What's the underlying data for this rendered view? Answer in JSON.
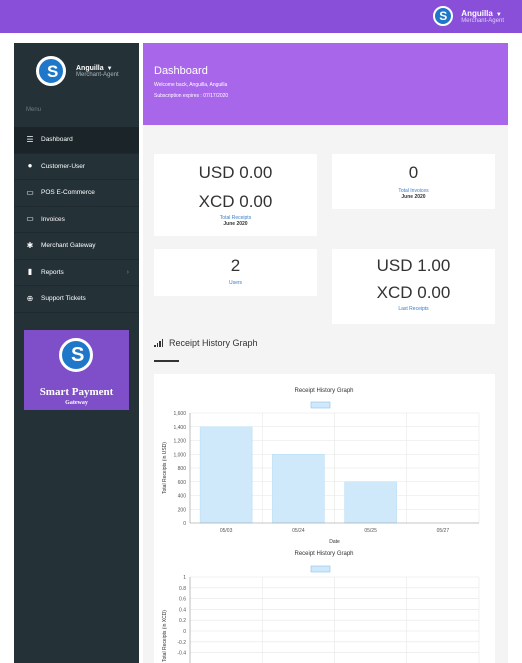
{
  "topbar": {
    "user_name": "Anguilla",
    "user_role": "Merchant-Agent"
  },
  "sidebar": {
    "user_name": "Anguilla",
    "user_role": "Merchant-Agent",
    "menu_label": "Menu",
    "items": [
      {
        "label": "Dashboard",
        "icon": "list-icon"
      },
      {
        "label": "Customer-User",
        "icon": "user-icon"
      },
      {
        "label": "POS E-Commerce",
        "icon": "card-icon"
      },
      {
        "label": "Invoices",
        "icon": "card-icon"
      },
      {
        "label": "Merchant Gateway",
        "icon": "gear-icon"
      },
      {
        "label": "Reports",
        "icon": "file-icon"
      },
      {
        "label": "Support Tickets",
        "icon": "lifebuoy-icon"
      }
    ],
    "promo": {
      "title": "Smart Payment",
      "subtitle": "Gateway"
    }
  },
  "hero": {
    "title": "Dashboard",
    "welcome": "Welcome back, Anguilla, Anguilla",
    "subscription": "Subscription expires : 07/17/2020"
  },
  "cards": {
    "receipts": {
      "usd": "USD 0.00",
      "xcd": "XCD 0.00",
      "label": "Total Receipts",
      "date": "June 2020"
    },
    "invoices": {
      "value": "0",
      "label": "Total Invoices",
      "date": "June 2020"
    },
    "users": {
      "value": "2",
      "label": "Users"
    },
    "last_receipts": {
      "usd": "USD 1.00",
      "xcd": "XCD 0.00",
      "label": "Last Receipts"
    }
  },
  "section_title": "Receipt History Graph",
  "chart_data": [
    {
      "type": "bar",
      "title": "Receipt History Graph",
      "xlabel": "Date",
      "ylabel": "Total Receipts (in USD)",
      "categories": [
        "05/03",
        "05/24",
        "05/25",
        "05/27"
      ],
      "values": [
        1400,
        1000,
        600,
        0
      ],
      "yticks": [
        "0",
        "200",
        "400",
        "600",
        "800",
        "1,000",
        "1,200",
        "1,400",
        "1,600"
      ],
      "ylim": [
        0,
        1600
      ],
      "color": "#cfe8fa",
      "grid": true
    },
    {
      "type": "bar",
      "title": "Receipt History Graph",
      "ylabel": "Total Receipts (in XCD)",
      "yticks": [
        "1",
        "0.8",
        "0.6",
        "0.4",
        "0.2",
        "0",
        "-0.2",
        "-0.4"
      ],
      "ylim": [
        -0.4,
        1
      ],
      "color": "#cfe8fa",
      "grid": true
    }
  ]
}
